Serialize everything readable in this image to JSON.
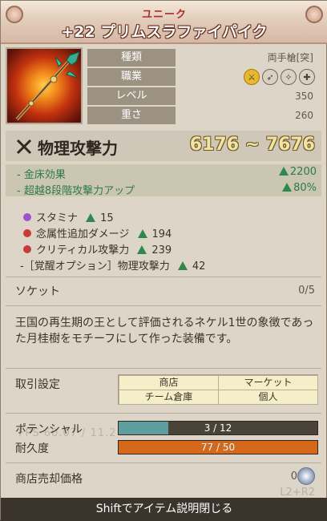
{
  "header": {
    "rarity": "ユニーク",
    "item_name": "+22 プリムスラファイパイク"
  },
  "info": {
    "type_label": "種類",
    "type_value": "両手槍[突]",
    "class_label": "職業",
    "class_icons": [
      "sword-class-icon",
      "bow-class-icon",
      "magic-class-icon",
      "cross-class-icon"
    ],
    "level_label": "レベル",
    "level_value": "350",
    "weight_label": "重さ",
    "weight_value": "260"
  },
  "attack": {
    "label": "物理攻撃力",
    "value": "6176 ~ 7676"
  },
  "effects": [
    {
      "label": "- 金床効果",
      "value": "2200"
    },
    {
      "label": "- 超越8段階攻撃力アップ",
      "value": "80%"
    }
  ],
  "stats": [
    {
      "label": "スタミナ",
      "value": "15",
      "color": "#9a55c9"
    },
    {
      "label": "念属性追加ダメージ",
      "value": "194",
      "color": "#c93a3a"
    },
    {
      "label": "クリティカル攻撃力",
      "value": "239",
      "color": "#c93a3a"
    }
  ],
  "awakening": {
    "label": "-［覚醒オプション］物理攻撃力",
    "value": "42"
  },
  "socket": {
    "label": "ソケット",
    "value": "0/5"
  },
  "description": "王国の再生期の王として評価されるネケル1世の象徴であった月桂樹をモチーフにして作った装備です。",
  "trade": {
    "label": "取引設定",
    "cells": [
      "商店",
      "マーケット",
      "チーム倉庫",
      "個人"
    ]
  },
  "potential": {
    "label": "ポテンシャル",
    "text": "3 / 12",
    "fraction": 0.25,
    "color": "#5f9ea0"
  },
  "durability": {
    "label": "耐久度",
    "text": "77 / 50",
    "fraction": 1.0,
    "color": "#d5681b"
  },
  "ghost_text": "FPS 60.07 / 11.2",
  "sell": {
    "label": "商店売却価格",
    "value": "0"
  },
  "controller_hint": "L2+R2",
  "footer": "Shiftでアイテム説明閉じる"
}
